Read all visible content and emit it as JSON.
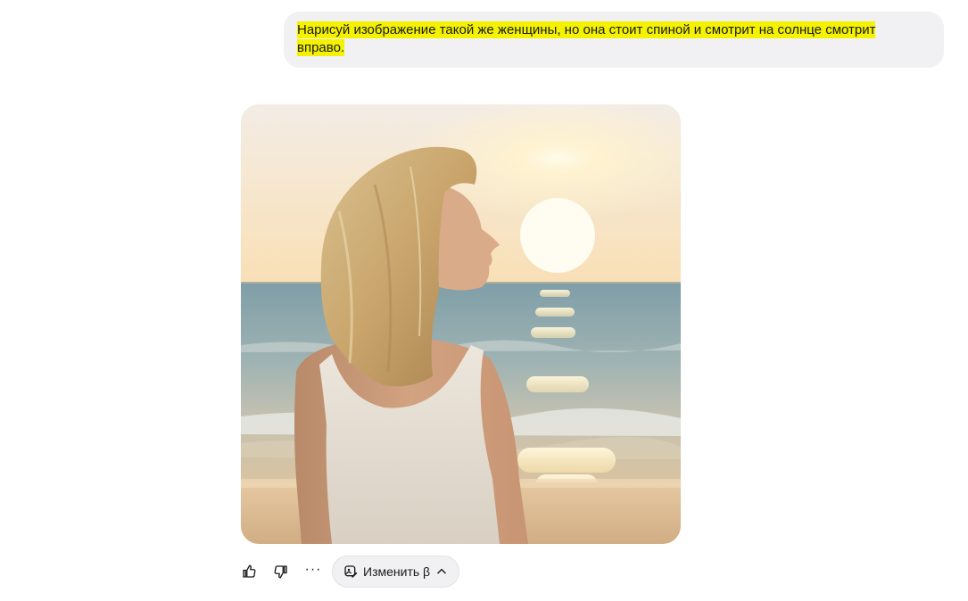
{
  "conversation": {
    "user_message": {
      "line1": "Нарисуй изображение такой же женщины, но она стоит спиной и смотрит на солнце смотрит",
      "line2": "вправо."
    },
    "assistant_image": {
      "alt": "woman-on-beach-at-sunset"
    }
  },
  "actions": {
    "like_icon": "thumbs-up-icon",
    "dislike_icon": "thumbs-down-icon",
    "more_label": "···",
    "edit_label": "Изменить β",
    "edit_icon": "edit-image-icon",
    "chevron_icon": "chevron-up-icon"
  },
  "colors": {
    "highlight": "#f4f200",
    "bubble": "#f1f1f3",
    "text": "#1a1a1a"
  }
}
